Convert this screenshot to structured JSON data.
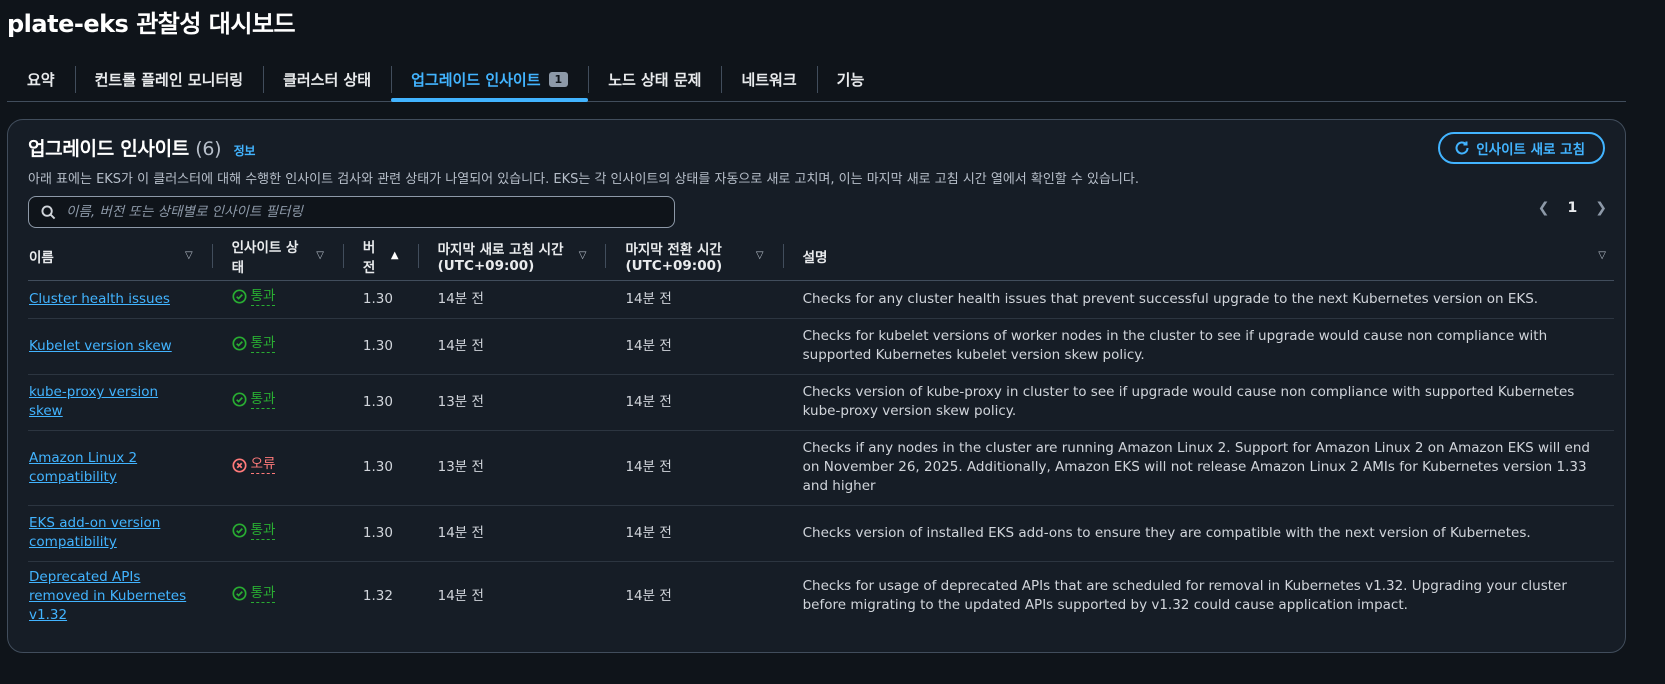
{
  "page_title": "plate-eks 관찰성 대시보드",
  "tabs": [
    {
      "label": "요약"
    },
    {
      "label": "컨트롤 플레인 모니터링"
    },
    {
      "label": "클러스터 상태"
    },
    {
      "label": "업그레이드 인사이트",
      "badge": "1",
      "active": true
    },
    {
      "label": "노드 상태 문제"
    },
    {
      "label": "네트워크"
    },
    {
      "label": "기능"
    }
  ],
  "panel": {
    "title": "업그레이드 인사이트",
    "count": "(6)",
    "info": "정보",
    "description": "아래 표에는 EKS가 이 클러스터에 대해 수행한 인사이트 검사와 관련 상태가 나열되어 있습니다. EKS는 각 인사이트의 상태를 자동으로 새로 고치며, 이는 마지막 새로 고침 시간 열에서 확인할 수 있습니다.",
    "refresh_label": "인사이트 새로 고침",
    "search_placeholder": "이름, 버전 또는 상태별로 인사이트 필터링",
    "page_number": "1"
  },
  "table": {
    "headers": {
      "name": "이름",
      "status": "인사이트 상태",
      "version": "버전",
      "last_refresh": "마지막 새로 고침 시간 (UTC+09:00)",
      "last_transition": "마지막 전환 시간 (UTC+09:00)",
      "description": "설명"
    },
    "rows": [
      {
        "name": "Cluster health issues",
        "status": "통과",
        "version": "1.30",
        "last_refresh": "14분 전",
        "last_transition": "14분 전",
        "description": "Checks for any cluster health issues that prevent successful upgrade to the next Kubernetes version on EKS."
      },
      {
        "name": "Kubelet version skew",
        "status": "통과",
        "version": "1.30",
        "last_refresh": "14분 전",
        "last_transition": "14분 전",
        "description": "Checks for kubelet versions of worker nodes in the cluster to see if upgrade would cause non compliance with supported Kubernetes kubelet version skew policy."
      },
      {
        "name": "kube-proxy version skew",
        "status": "통과",
        "version": "1.30",
        "last_refresh": "13분 전",
        "last_transition": "14분 전",
        "description": "Checks version of kube-proxy in cluster to see if upgrade would cause non compliance with supported Kubernetes kube-proxy version skew policy."
      },
      {
        "name": "Amazon Linux 2 compatibility",
        "status": "오류",
        "version": "1.30",
        "last_refresh": "13분 전",
        "last_transition": "14분 전",
        "description": "Checks if any nodes in the cluster are running Amazon Linux 2. Support for Amazon Linux 2 on Amazon EKS will end on November 26, 2025. Additionally, Amazon EKS will not release Amazon Linux 2 AMIs for Kubernetes version 1.33 and higher"
      },
      {
        "name": "EKS add-on version compatibility",
        "status": "통과",
        "version": "1.30",
        "last_refresh": "14분 전",
        "last_transition": "14분 전",
        "description": "Checks version of installed EKS add-ons to ensure they are compatible with the next version of Kubernetes."
      },
      {
        "name": "Deprecated APIs removed in Kubernetes v1.32",
        "status": "통과",
        "version": "1.32",
        "last_refresh": "14분 전",
        "last_transition": "14분 전",
        "description": "Checks for usage of deprecated APIs that are scheduled for removal in Kubernetes v1.32. Upgrading your cluster before migrating to the updated APIs supported by v1.32 could cause application impact."
      }
    ]
  },
  "colors": {
    "accent": "#42b4ff",
    "pass": "#29ad32",
    "error": "#ff7a7a",
    "background": "#0f141a",
    "panel": "#161d26"
  }
}
